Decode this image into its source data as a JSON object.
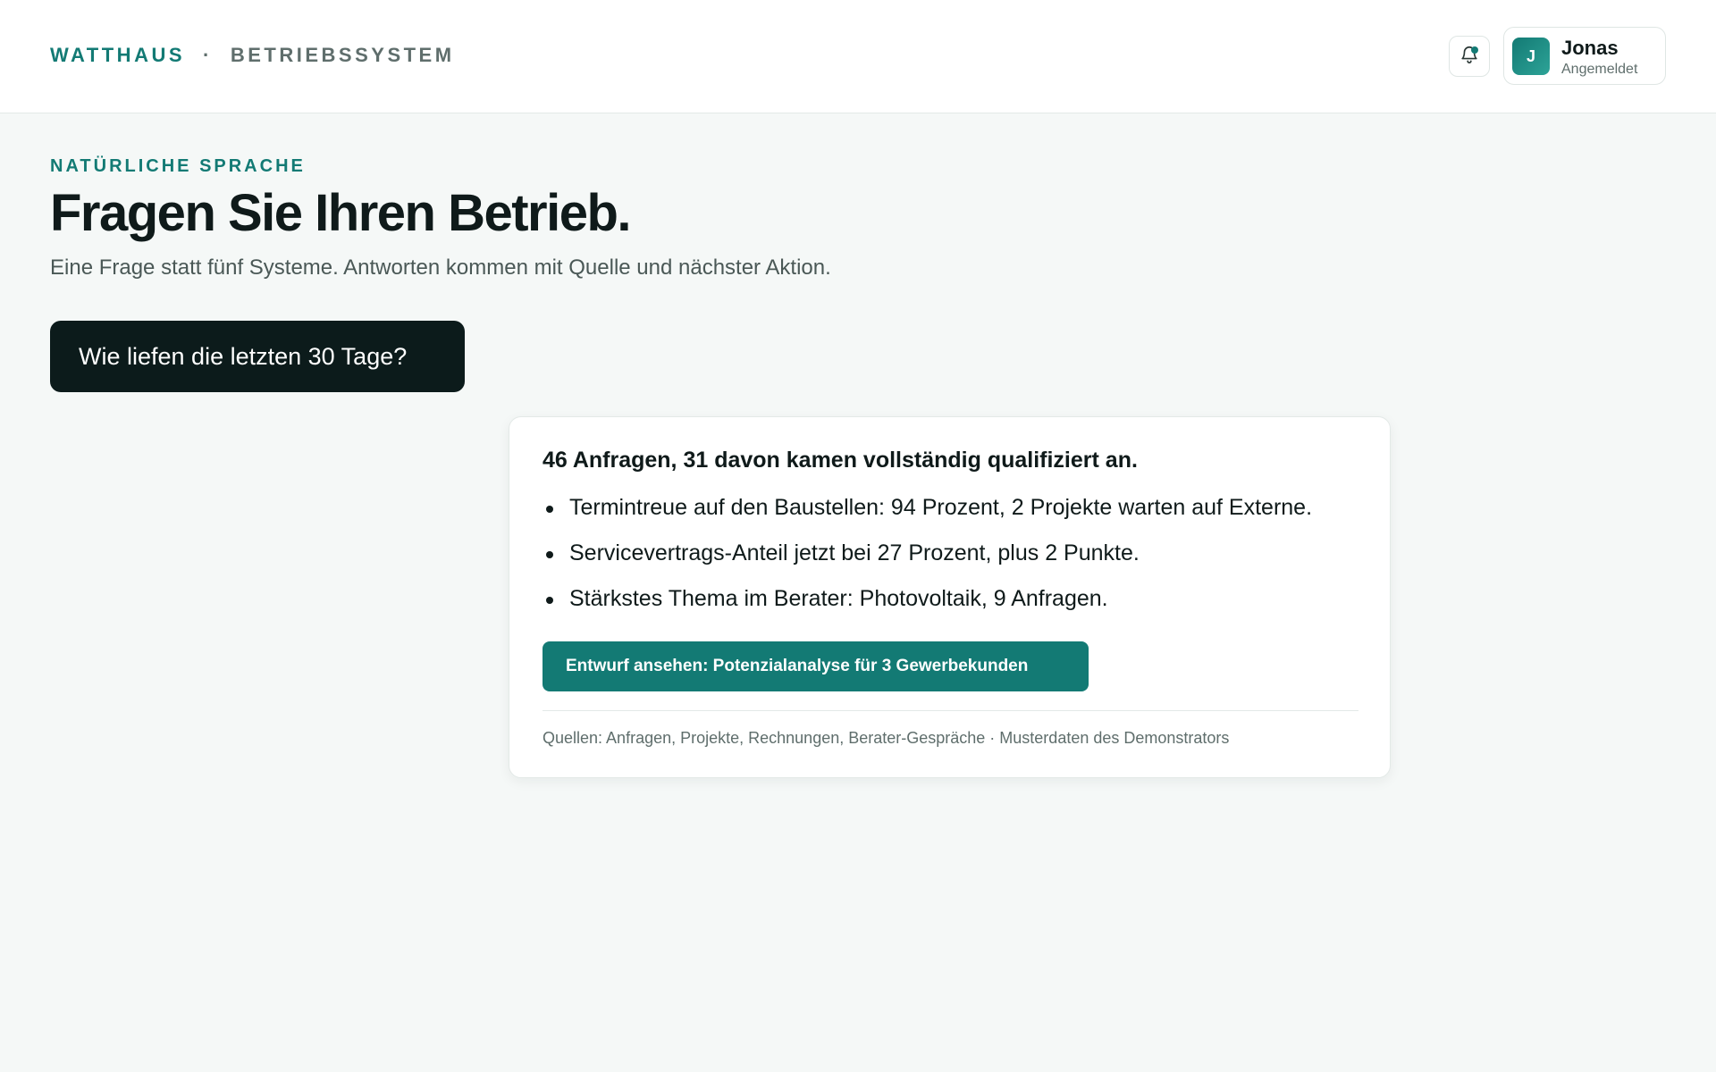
{
  "header": {
    "brand_name": "WATTHAUS",
    "brand_separator": "·",
    "brand_system": "BETRIEBSSYSTEM",
    "notification_icon": "bell-icon",
    "user": {
      "initial": "J",
      "name": "Jonas",
      "status": "Angemeldet"
    }
  },
  "intro": {
    "eyebrow": "NATÜRLICHE SPRACHE",
    "headline": "Fragen Sie Ihren Betrieb.",
    "subline": "Eine Frage statt fünf Systeme. Antworten kommen mit Quelle und nächster Aktion."
  },
  "query": {
    "question": "Wie liefen die letzten 30 Tage?"
  },
  "answer": {
    "title": "46 Anfragen, 31 davon kamen vollständig qualifiziert an.",
    "bullets": [
      "Termintreue auf den Baustellen: 94 Prozent, 2 Projekte warten auf Externe.",
      "Servicevertrags-Anteil jetzt bei 27 Prozent, plus 2 Punkte.",
      "Stärkstes Thema im Berater: Photovoltaik, 9 Anfragen."
    ],
    "action_label": "Entwurf ansehen: Potenzialanalyse für 3 Gewerbekunden",
    "sources": "Quellen: Anfragen, Projekte, Rechnungen, Berater-Gespräche · Musterdaten des Demonstrators"
  },
  "colors": {
    "accent": "#137a74",
    "dark": "#0c1b1b",
    "background": "#f5f8f7"
  }
}
